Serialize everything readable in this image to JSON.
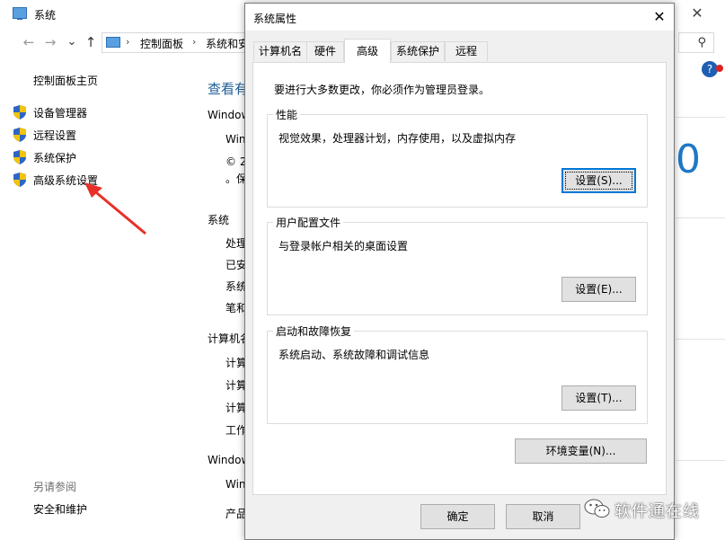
{
  "background_window": {
    "title": "系统",
    "close_glyph": "✕",
    "nav": {
      "back": "←",
      "forward": "→",
      "up": "↑"
    },
    "address": {
      "separator": "›",
      "segments": [
        "控制面板",
        "系统和安"
      ]
    },
    "search_glyph": "⚲",
    "sidebar": {
      "title": "控制面板主页",
      "items": [
        {
          "label": "设备管理器"
        },
        {
          "label": "远程设置"
        },
        {
          "label": "系统保护"
        },
        {
          "label": "高级系统设置"
        }
      ],
      "see_also": "另请参阅",
      "security": "安全和维护"
    },
    "main": {
      "heading": "查看有",
      "edition_label": "Window",
      "edition_lines": [
        "Win",
        "© 2",
        "。保"
      ],
      "system_label": "系统",
      "system_lines": [
        "处理",
        "已安",
        "系统",
        "笔和"
      ],
      "computer_label": "计算机名",
      "computer_lines": [
        "计算",
        "计算",
        "计算",
        "工作"
      ],
      "activation_label": "Window",
      "activation_lines": [
        "Win",
        "产品"
      ],
      "logo_digit": "0",
      "help": "?"
    }
  },
  "dialog": {
    "title": "系统属性",
    "close_glyph": "✕",
    "tabs": [
      {
        "label": "计算机名"
      },
      {
        "label": "硬件"
      },
      {
        "label": "高级",
        "active": true
      },
      {
        "label": "系统保护"
      },
      {
        "label": "远程"
      }
    ],
    "admin_note": "要进行大多数更改，你必须作为管理员登录。",
    "groups": [
      {
        "title": "性能",
        "desc": "视觉效果，处理器计划，内存使用，以及虚拟内存",
        "button": "设置(S)..."
      },
      {
        "title": "用户配置文件",
        "desc": "与登录帐户相关的桌面设置",
        "button": "设置(E)..."
      },
      {
        "title": "启动和故障恢复",
        "desc": "系统启动、系统故障和调试信息",
        "button": "设置(T)..."
      }
    ],
    "env_button": "环境变量(N)...",
    "ok_button": "确定",
    "cancel_button": "取消"
  },
  "watermark": "软件通在线",
  "colors": {
    "accent": "#0078d7",
    "link_heading": "#1e5d96",
    "arrow": "#e8302a"
  }
}
